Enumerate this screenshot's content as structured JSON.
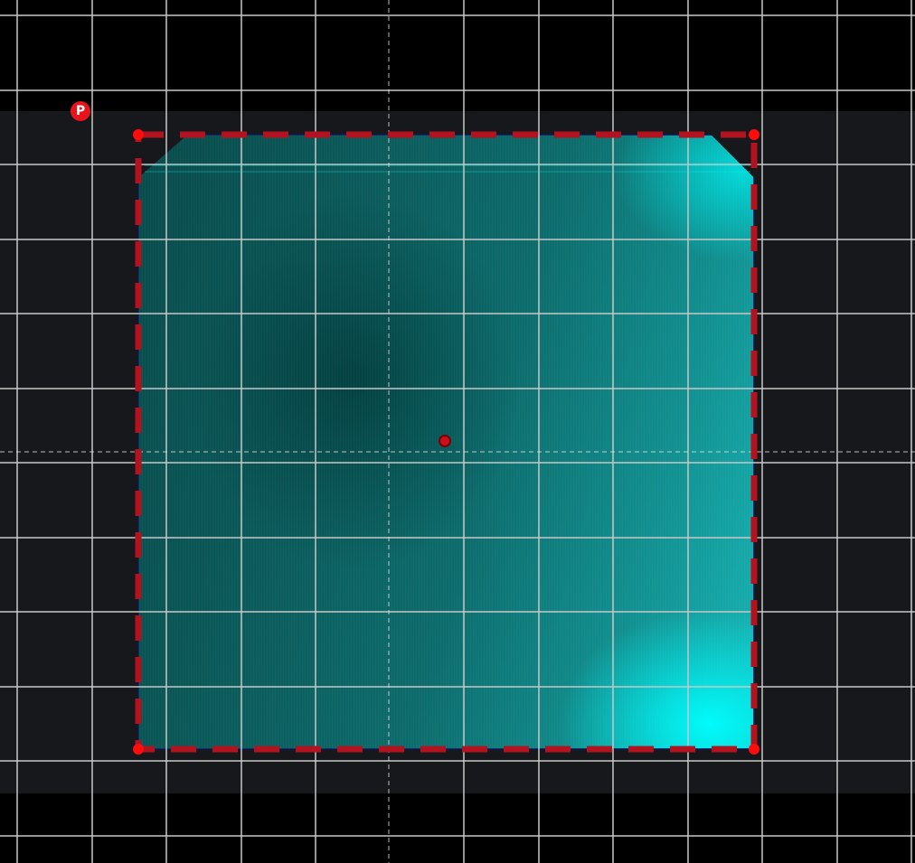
{
  "viewer": {
    "background_color": "#000000",
    "band_color": "#17181b",
    "grid_line_color": "#c8c8c8",
    "crosshair_color": "#e6e6e6"
  },
  "cell_image": {
    "tint_color": "#00ffff"
  },
  "selection": {
    "outline_color": "#b3121f",
    "handle_color": "#ff0d0d"
  },
  "center_marker": {
    "color": "#c8101a"
  },
  "pivot_marker": {
    "label": "P",
    "color": "#e8141c"
  }
}
